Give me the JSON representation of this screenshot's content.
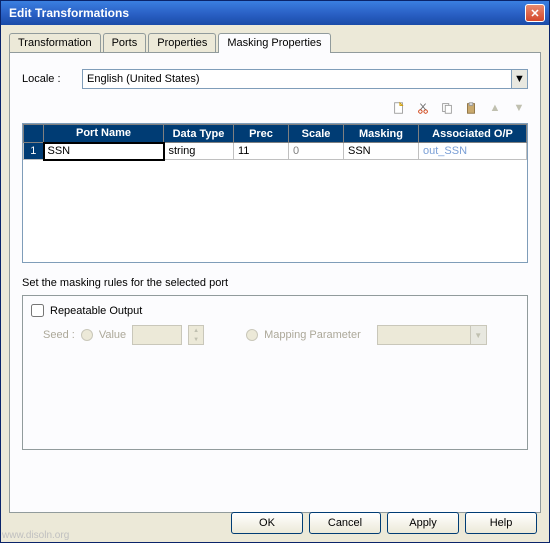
{
  "window": {
    "title": "Edit Transformations"
  },
  "tabs": [
    {
      "label": "Transformation"
    },
    {
      "label": "Ports"
    },
    {
      "label": "Properties"
    },
    {
      "label": "Masking Properties"
    }
  ],
  "locale": {
    "label": "Locale :",
    "value": "English (United States)"
  },
  "grid": {
    "headers": {
      "rownum": "",
      "portname": "Port Name",
      "datatype": "Data Type",
      "prec": "Prec",
      "scale": "Scale",
      "masking": "Masking",
      "assoc": "Associated O/P"
    },
    "rows": [
      {
        "num": "1",
        "portname": "SSN",
        "datatype": "string",
        "prec": "11",
        "scale": "0",
        "masking": "SSN",
        "assoc": "out_SSN"
      }
    ]
  },
  "rules": {
    "caption": "Set the masking rules for the selected port",
    "repeatable": "Repeatable Output",
    "seed_label": "Seed :",
    "value_label": "Value",
    "mapping_label": "Mapping Parameter"
  },
  "buttons": {
    "ok": "OK",
    "cancel": "Cancel",
    "apply": "Apply",
    "help": "Help"
  },
  "watermark": "www.disoln.org"
}
